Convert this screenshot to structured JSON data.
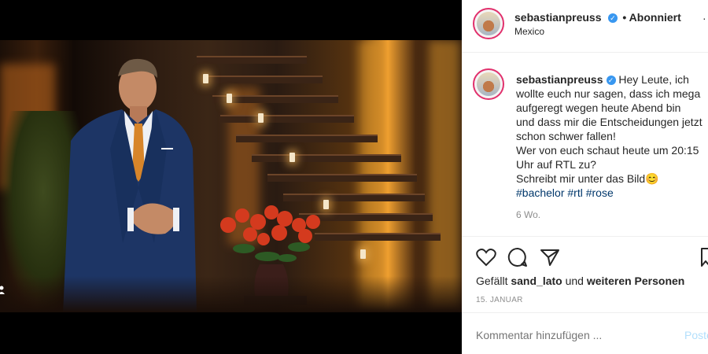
{
  "header": {
    "username": "sebastianpreuss",
    "follow_status": "• Abonniert",
    "location": "Mexico"
  },
  "caption": {
    "username": "sebastianpreuss",
    "line1": "Hey Leute, ich",
    "line2": "wollte euch nur sagen, dass ich mega",
    "line3": "aufgeregt wegen heute Abend bin",
    "line4": "und dass mir die Entscheidungen jetzt",
    "line5": "schon schwer fallen!",
    "line6": "Wer von euch schaut heute um 20:15",
    "line7": "Uhr auf RTL zu?",
    "line8": "Schreibt mir unter das Bild",
    "emoji": "😊",
    "hashtags": [
      "#bachelor",
      "#rtl",
      "#rose"
    ],
    "age": "6 Wo."
  },
  "likes": {
    "prefix": "Gefällt",
    "user": "sand_lato",
    "mid": "und",
    "rest": "weiteren Personen"
  },
  "date": "15. JANUAR",
  "comment": {
    "placeholder": "Kommentar hinzufügen ...",
    "post_label": "Posten"
  },
  "icons": [
    "heart-icon",
    "comment-icon",
    "share-icon",
    "bookmark-icon",
    "verified-icon",
    "more-icon"
  ]
}
